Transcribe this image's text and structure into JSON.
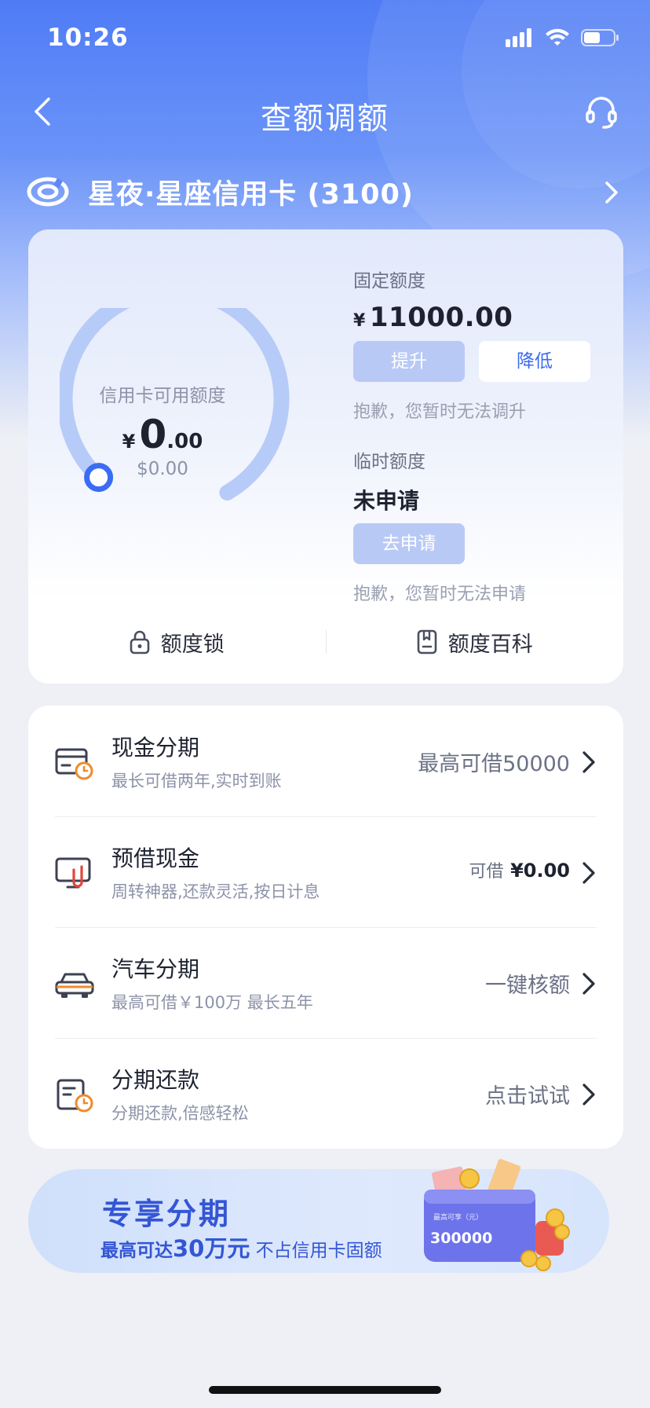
{
  "status_bar": {
    "time": "10:26"
  },
  "nav": {
    "title": "查额调额"
  },
  "card": {
    "name": "星夜·星座信用卡 (3100)"
  },
  "available": {
    "label": "信用卡可用额度",
    "currency": "¥",
    "integer": "0",
    "decimal": ".00",
    "usd": "$0.00",
    "usage_fraction": 0
  },
  "fixed_limit": {
    "label": "固定额度",
    "currency": "¥",
    "amount": "11000.00",
    "raise_label": "提升",
    "lower_label": "降低",
    "hint": "抱歉，您暂时无法调升"
  },
  "temp_limit": {
    "label": "临时额度",
    "status": "未申请",
    "apply_label": "去申请",
    "hint": "抱歉，您暂时无法申请"
  },
  "quick_links": {
    "lock": "额度锁",
    "wiki": "额度百科"
  },
  "services": [
    {
      "title": "现金分期",
      "subtitle": "最长可借两年,实时到账",
      "right": "最高可借50000"
    },
    {
      "title": "预借现金",
      "subtitle": "周转神器,还款灵活,按日计息",
      "right_prefix": "可借",
      "right_value": "¥0.00"
    },
    {
      "title": "汽车分期",
      "subtitle": "最高可借￥100万 最长五年",
      "right": "一键核额"
    },
    {
      "title": "分期还款",
      "subtitle": "分期还款,倍感轻松",
      "right": "点击试试"
    }
  ],
  "banner": {
    "title": "专享分期",
    "sub_prefix": "最高可达",
    "sub_highlight": "30万元",
    "sub_suffix": " 不占信用卡固额",
    "art_caption": "最高可享（元）",
    "art_amount": "300000"
  },
  "colors": {
    "primary": "#3a6cf4",
    "disabled_button": "#b9c9f6",
    "orange_accent": "#f08a2c"
  }
}
